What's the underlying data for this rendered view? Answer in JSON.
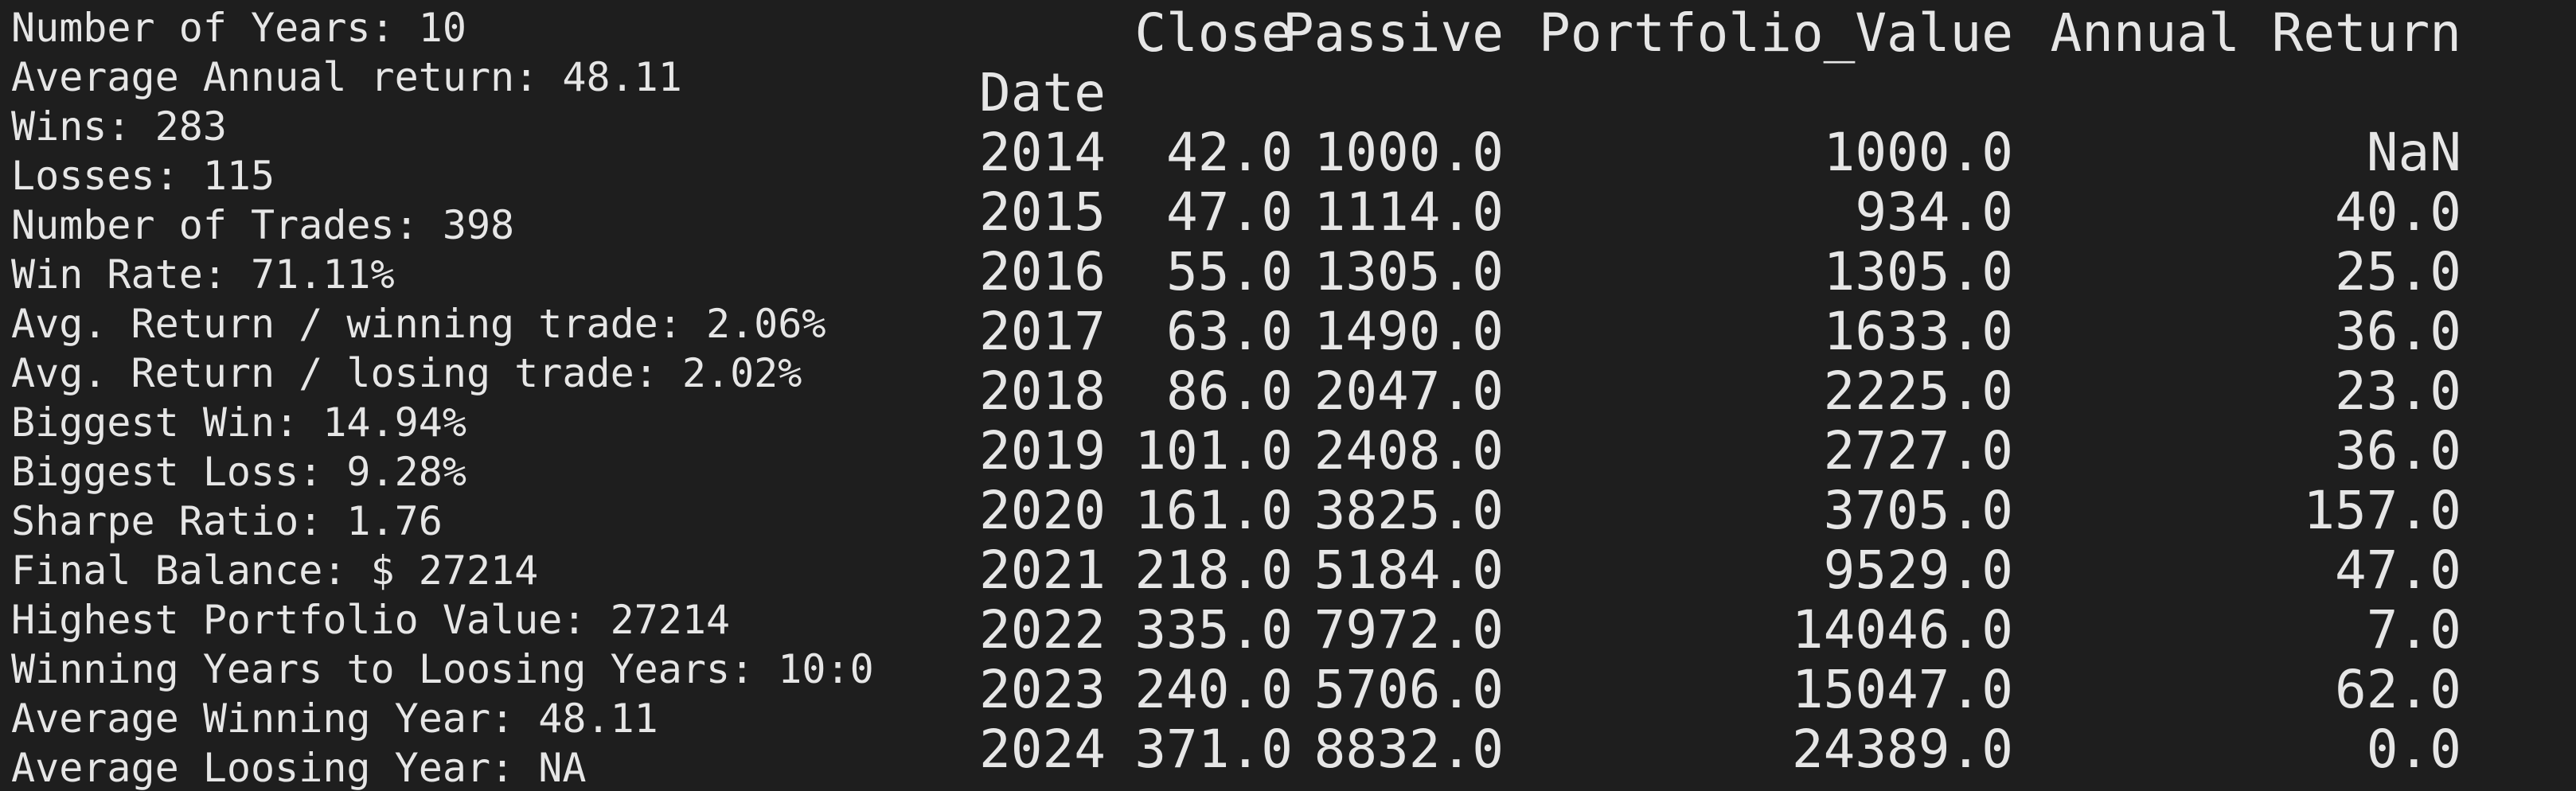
{
  "stats": [
    "Number of Years: 10",
    "Average Annual return: 48.11",
    "Wins: 283",
    "Losses: 115",
    "Number of Trades: 398",
    "Win Rate: 71.11%",
    "Avg. Return / winning trade: 2.06%",
    "Avg. Return / losing trade: 2.02%",
    "Biggest Win: 14.94%",
    "Biggest Loss: 9.28%",
    "Sharpe Ratio: 1.76",
    "Final Balance: $ 27214",
    "Highest Portfolio Value: 27214",
    "Winning Years to Loosing Years: 10:0",
    "Average Winning Year: 48.11",
    "Average Loosing Year: NA"
  ],
  "dataframe": {
    "columns": [
      "Close",
      "Passive",
      "Portfolio_Value",
      "Annual Return"
    ],
    "index_name": "Date",
    "rows": [
      {
        "date": "2014",
        "close": "42.0",
        "passive": "1000.0",
        "portfolio_value": "1000.0",
        "annual_return": "NaN"
      },
      {
        "date": "2015",
        "close": "47.0",
        "passive": "1114.0",
        "portfolio_value": "934.0",
        "annual_return": "40.0"
      },
      {
        "date": "2016",
        "close": "55.0",
        "passive": "1305.0",
        "portfolio_value": "1305.0",
        "annual_return": "25.0"
      },
      {
        "date": "2017",
        "close": "63.0",
        "passive": "1490.0",
        "portfolio_value": "1633.0",
        "annual_return": "36.0"
      },
      {
        "date": "2018",
        "close": "86.0",
        "passive": "2047.0",
        "portfolio_value": "2225.0",
        "annual_return": "23.0"
      },
      {
        "date": "2019",
        "close": "101.0",
        "passive": "2408.0",
        "portfolio_value": "2727.0",
        "annual_return": "36.0"
      },
      {
        "date": "2020",
        "close": "161.0",
        "passive": "3825.0",
        "portfolio_value": "3705.0",
        "annual_return": "157.0"
      },
      {
        "date": "2021",
        "close": "218.0",
        "passive": "5184.0",
        "portfolio_value": "9529.0",
        "annual_return": "47.0"
      },
      {
        "date": "2022",
        "close": "335.0",
        "passive": "7972.0",
        "portfolio_value": "14046.0",
        "annual_return": "7.0"
      },
      {
        "date": "2023",
        "close": "240.0",
        "passive": "5706.0",
        "portfolio_value": "15047.0",
        "annual_return": "62.0"
      },
      {
        "date": "2024",
        "close": "371.0",
        "passive": "8832.0",
        "portfolio_value": "24389.0",
        "annual_return": "0.0"
      }
    ]
  }
}
